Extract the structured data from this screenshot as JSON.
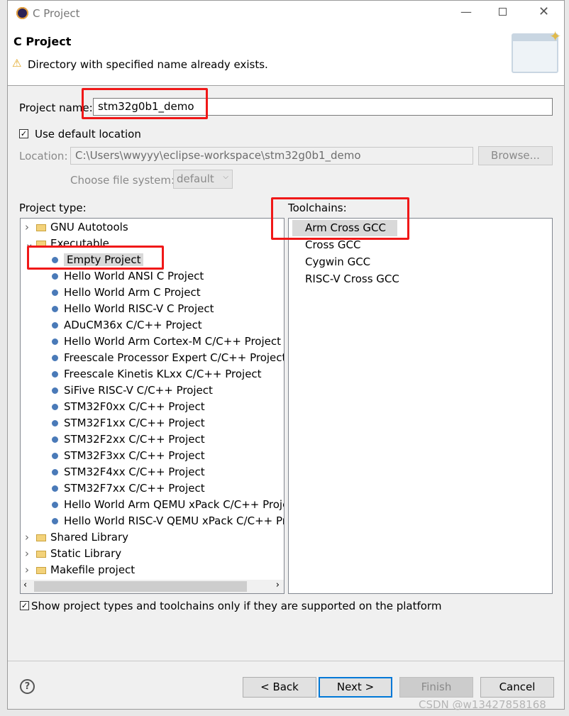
{
  "window": {
    "title": "C Project"
  },
  "header": {
    "title": "C Project",
    "message": "Directory with specified name already exists."
  },
  "form": {
    "project_name_label": "Project name:",
    "project_name_value": "stm32g0b1_demo",
    "use_default_location_label": "Use default location",
    "use_default_location_checked": true,
    "location_label": "Location:",
    "location_value": "C:\\Users\\wwyyy\\eclipse-workspace\\stm32g0b1_demo",
    "browse_label": "Browse...",
    "file_system_label": "Choose file system:",
    "file_system_value": "default"
  },
  "project_type": {
    "label": "Project type:",
    "items": [
      {
        "label": "GNU Autotools",
        "kind": "folder",
        "expanded": false
      },
      {
        "label": "Executable",
        "kind": "folder",
        "expanded": true
      },
      {
        "label": "Empty Project",
        "kind": "leaf",
        "selected": true
      },
      {
        "label": "Hello World ANSI C Project",
        "kind": "leaf"
      },
      {
        "label": "Hello World Arm C Project",
        "kind": "leaf"
      },
      {
        "label": "Hello World RISC-V C Project",
        "kind": "leaf"
      },
      {
        "label": "ADuCM36x C/C++ Project",
        "kind": "leaf"
      },
      {
        "label": "Hello World Arm Cortex-M C/C++ Project",
        "kind": "leaf"
      },
      {
        "label": "Freescale Processor Expert C/C++ Project",
        "kind": "leaf"
      },
      {
        "label": "Freescale Kinetis KLxx C/C++ Project",
        "kind": "leaf"
      },
      {
        "label": "SiFive RISC-V C/C++ Project",
        "kind": "leaf"
      },
      {
        "label": "STM32F0xx C/C++ Project",
        "kind": "leaf"
      },
      {
        "label": "STM32F1xx C/C++ Project",
        "kind": "leaf"
      },
      {
        "label": "STM32F2xx C/C++ Project",
        "kind": "leaf"
      },
      {
        "label": "STM32F3xx C/C++ Project",
        "kind": "leaf"
      },
      {
        "label": "STM32F4xx C/C++ Project",
        "kind": "leaf"
      },
      {
        "label": "STM32F7xx C/C++ Project",
        "kind": "leaf"
      },
      {
        "label": "Hello World Arm QEMU xPack C/C++ Project",
        "kind": "leaf"
      },
      {
        "label": "Hello World RISC-V QEMU xPack C/C++ Project",
        "kind": "leaf"
      },
      {
        "label": "Shared Library",
        "kind": "folder",
        "expanded": false
      },
      {
        "label": "Static Library",
        "kind": "folder",
        "expanded": false
      },
      {
        "label": "Makefile project",
        "kind": "folder",
        "expanded": false
      }
    ]
  },
  "toolchains": {
    "label": "Toolchains:",
    "items": [
      "Arm Cross GCC",
      "Cross GCC",
      "Cygwin GCC",
      "RISC-V Cross GCC"
    ],
    "selected": "Arm Cross GCC"
  },
  "show_supported_label": "Show project types and toolchains only if they are supported on the platform",
  "show_supported_checked": true,
  "buttons": {
    "back": "< Back",
    "next": "Next >",
    "finish": "Finish",
    "cancel": "Cancel"
  },
  "watermark": "CSDN @w13427858168",
  "colors": {
    "annotation": "#f01818",
    "focus": "#0078d7"
  }
}
